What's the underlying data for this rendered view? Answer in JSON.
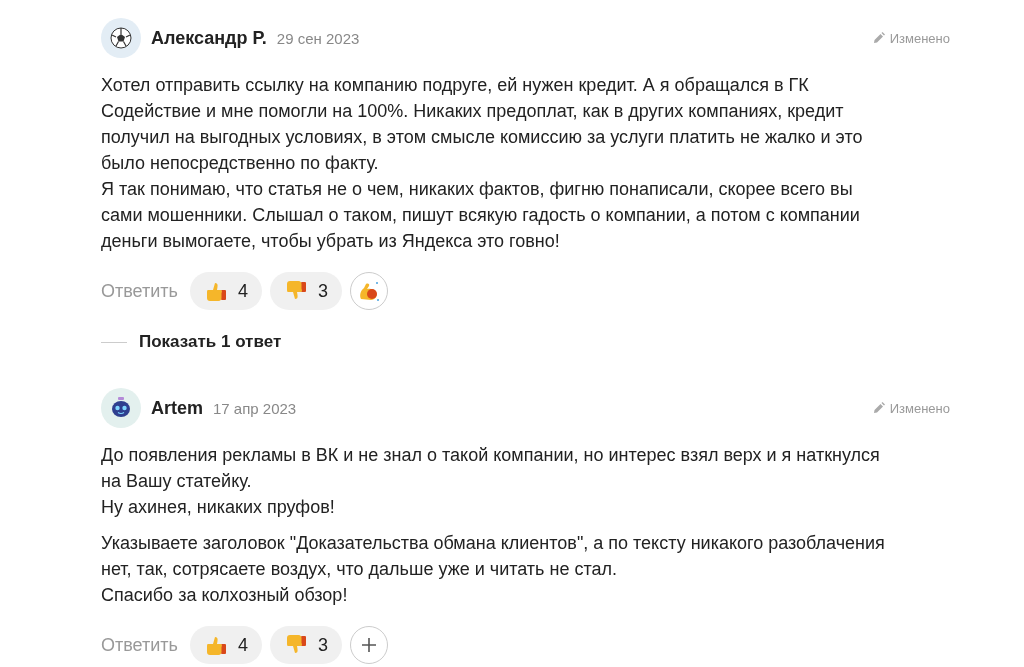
{
  "comments": [
    {
      "author": "Александр Р.",
      "date": "29 сен 2023",
      "avatar": {
        "kind": "ball"
      },
      "edited_label": "Изменено",
      "paragraphs": [
        "Хотел отправить ссылку на компанию подруге, ей нужен кредит. А я обращался в ГК Содействие и мне помогли на 100%. Никаких предоплат, как в других компаниях, кредит получил на выгодных условиях, в этом смысле комиссию за услуги платить не жалко и это было непосредственно по факту.\nЯ так понимаю, что статья не о чем, никаких фактов, фигню понаписали, скорее всего вы сами мошенники. Слышал о таком, пишут всякую гадость о компании, а потом с компании деньги вымогаете, чтобы убрать из Яндекса это говно!"
      ],
      "reply_label": "Ответить",
      "likes": "4",
      "dislikes": "3",
      "extra_reaction": {
        "kind": "muscle"
      },
      "replies_link": "Показать 1 ответ"
    },
    {
      "author": "Artem",
      "date": "17 апр 2023",
      "avatar": {
        "kind": "robot"
      },
      "edited_label": "Изменено",
      "paragraphs": [
        "До появления рекламы в ВК и не знал о такой компании, но интерес взял верх и я наткнулся на Вашу статейку.\nНу ахинея, никаких пруфов!",
        "Указываете заголовок \"Доказательства обмана клиентов\", а по тексту никакого разоблачения нет, так, сотрясаете воздух, что дальше уже и читать не стал.\nСпасибо за колхозный обзор!"
      ],
      "reply_label": "Ответить",
      "likes": "4",
      "dislikes": "3",
      "extra_reaction": {
        "kind": "add"
      }
    }
  ]
}
